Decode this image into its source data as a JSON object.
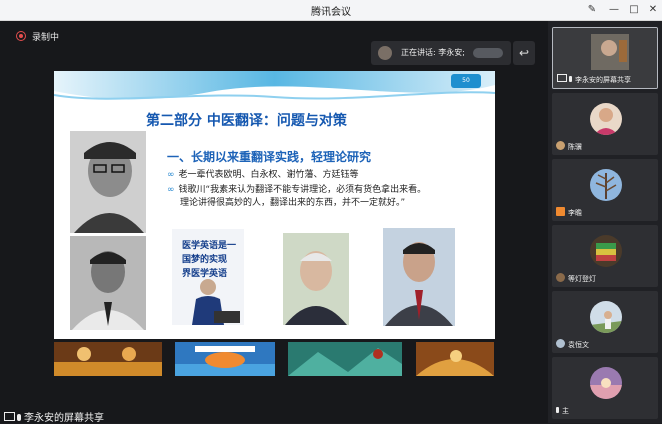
{
  "window": {
    "title": "腾讯会议"
  },
  "window_controls": {
    "pin": "✎",
    "minimize": "—",
    "maximize": "□",
    "close": "✕"
  },
  "recording": {
    "label": "录制中"
  },
  "speaking": {
    "label": "正在讲话: 李永安;"
  },
  "back_icon": "↩",
  "slide": {
    "logo": "50",
    "title": "第二部分      中医翻译：问题与对策",
    "heading": "一、长期以来重翻译实践，轻理论研究",
    "bullet_symbol": "∞",
    "bullets": [
      "老一辈代表欧明、白永权、谢竹藩、方廷钰等",
      "钱歌川“我素来认为翻译不能专讲理论，必须有货色拿出来看。",
      "理论讲得很高妙的人，翻译出来的东西，并不一定就好。”"
    ],
    "photo_text": [
      "医学英语是一",
      "国梦的实现",
      "界医学英语"
    ]
  },
  "presenter": {
    "label": "李永安的屏幕共享"
  },
  "participants": [
    {
      "name": "李永安的屏幕共享"
    },
    {
      "name": "陈骥"
    },
    {
      "name": "李瞻"
    },
    {
      "name": "等灯登灯"
    },
    {
      "name": "袁恒文"
    },
    {
      "name": "主"
    }
  ],
  "colors": {
    "accent": "#1558b0",
    "recording": "#e34d4d",
    "background": "#1c1d20"
  }
}
